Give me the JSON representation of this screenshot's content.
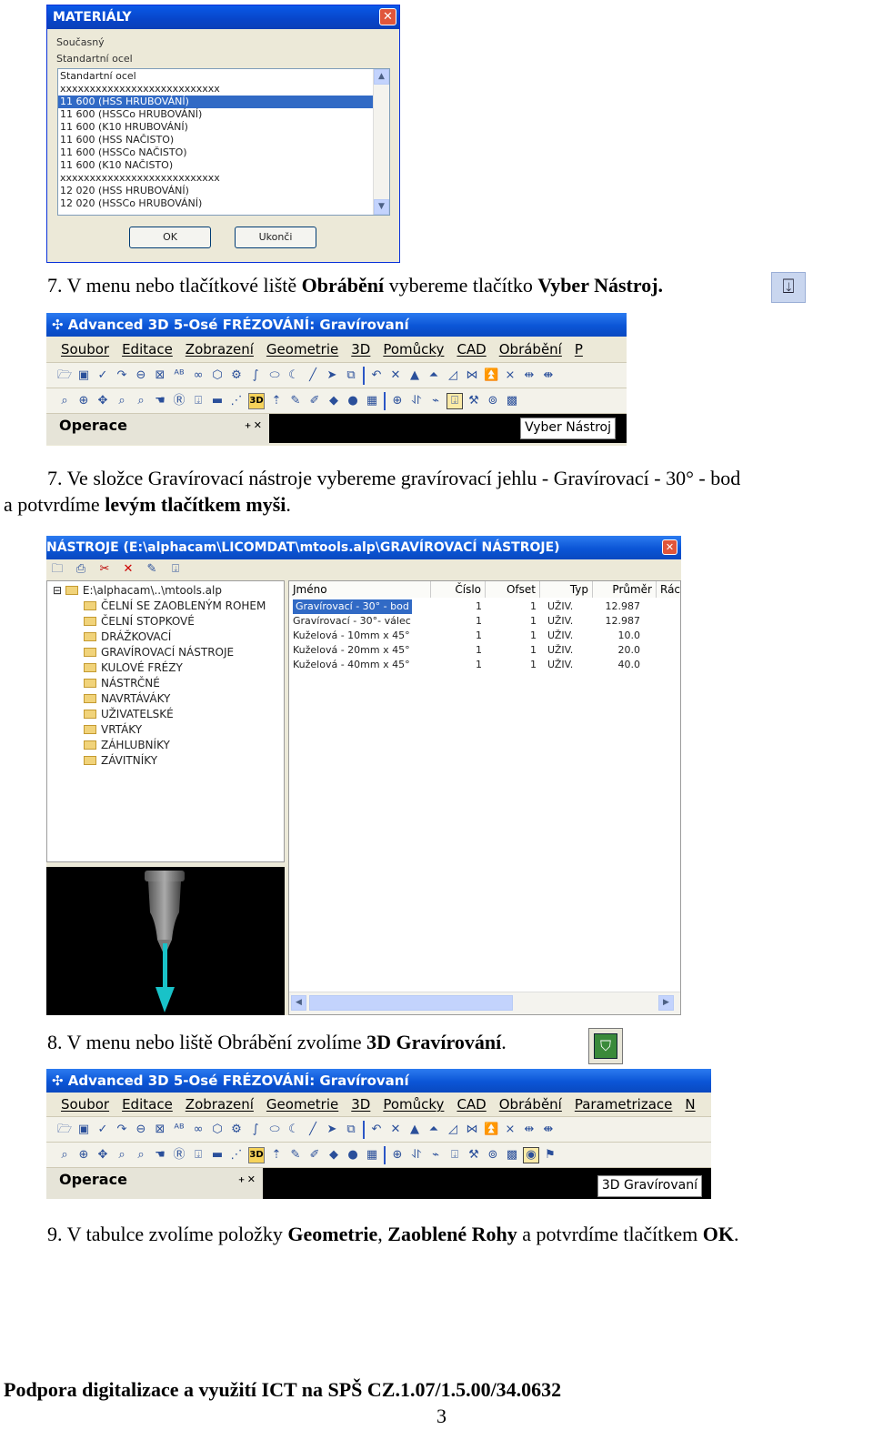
{
  "materials_dialog": {
    "title": "MATERIÁLY",
    "current_label": "Současný",
    "current_value": "Standartní ocel",
    "items": [
      "Standartní ocel",
      "xxxxxxxxxxxxxxxxxxxxxxxxxxx",
      "11 600    (HSS HRUBOVÁNÍ)",
      "11 600    (HSSCo HRUBOVÁNÍ)",
      "11 600    (K10 HRUBOVÁNÍ)",
      "11 600    (HSS NAČISTO)",
      "11 600    (HSSCo NAČISTO)",
      "11 600    (K10 NAČISTO)",
      "xxxxxxxxxxxxxxxxxxxxxxxxxxx",
      "12 020    (HSS HRUBOVÁNÍ)",
      "12 020    (HSSCo HRUBOVÁNÍ)"
    ],
    "selected_index": 2,
    "ok_label": "OK",
    "close_label": "Ukonči"
  },
  "step7a": {
    "prefix": "7. V menu nebo tlačítkové liště ",
    "b1": "Obrábění",
    "mid": " vybereme tlačítko ",
    "b2": "Vyber Nástroj."
  },
  "shot1": {
    "title": "Advanced 3D 5-Osé FRÉZOVÁNÍ: Gravírovaní",
    "menu": [
      "Soubor",
      "Editace",
      "Zobrazení",
      "Geometrie",
      "3D",
      "Pomůcky",
      "CAD",
      "Obrábění",
      "P"
    ],
    "panel": "Operace",
    "tooltip": "Vyber Nástroj"
  },
  "step7b": {
    "line1": "7. Ve složce Gravírovací nástroje  vybereme gravírovací jehlu - Gravírovací  - 30° - bod",
    "line2_prefix": "a potvrdíme ",
    "line2_bold": "levým tlačítkem myši",
    "line2_suffix": "."
  },
  "tools_dialog": {
    "title": "NÁSTROJE (E:\\alphacam\\LICOMDAT\\mtools.alp\\GRAVÍROVACÍ NÁSTROJE)",
    "root": "E:\\alphacam\\..\\mtools.alp",
    "folders": [
      "ČELNÍ SE ZAOBLENÝM ROHEM",
      "ČELNÍ STOPKOVÉ",
      "DRÁŽKOVACÍ",
      "GRAVÍROVACÍ NÁSTROJE",
      "KULOVÉ FRÉZY",
      "NÁSTRČNÉ",
      "NAVRTÁVÁKY",
      "UŽIVATELSKÉ",
      "VRTÁKY",
      "ZÁHLUBNÍKY",
      "ZÁVITNÍKY"
    ],
    "columns": [
      "Jméno",
      "Číslo",
      "Ofset",
      "Typ",
      "Průměr",
      "Rác"
    ],
    "rows": [
      [
        "Gravírovací - 30° - bod",
        "1",
        "1",
        "UŽIV.",
        "12.987"
      ],
      [
        "Gravírovací - 30°- válec",
        "1",
        "1",
        "UŽIV.",
        "12.987"
      ],
      [
        "Kuželová  - 10mm x 45°",
        "1",
        "1",
        "UŽIV.",
        "10.0"
      ],
      [
        "Kuželová  - 20mm x 45°",
        "1",
        "1",
        "UŽIV.",
        "20.0"
      ],
      [
        "Kuželová  - 40mm x 45°",
        "1",
        "1",
        "UŽIV.",
        "40.0"
      ]
    ]
  },
  "step8": {
    "prefix": "8. V menu nebo liště Obrábění zvolíme ",
    "bold": "3D Gravírování",
    "suffix": "."
  },
  "shot2": {
    "title": "Advanced 3D 5-Osé FRÉZOVÁNÍ: Gravírovaní",
    "menu": [
      "Soubor",
      "Editace",
      "Zobrazení",
      "Geometrie",
      "3D",
      "Pomůcky",
      "CAD",
      "Obrábění",
      "Parametrizace",
      "N"
    ],
    "panel": "Operace",
    "tooltip": "3D Gravírovaní"
  },
  "step9": {
    "prefix": "9. V tabulce zvolíme položky ",
    "b1": "Geometrie",
    "sep": ", ",
    "b2": "Zaoblené Rohy",
    "mid": " a potvrdíme tlačítkem ",
    "b3": "OK",
    "end": "."
  },
  "footer": {
    "text": "Podpora digitalizace a využití ICT na SPŠ  CZ.1.07/1.5.00/34.0632",
    "page_number": "3"
  }
}
